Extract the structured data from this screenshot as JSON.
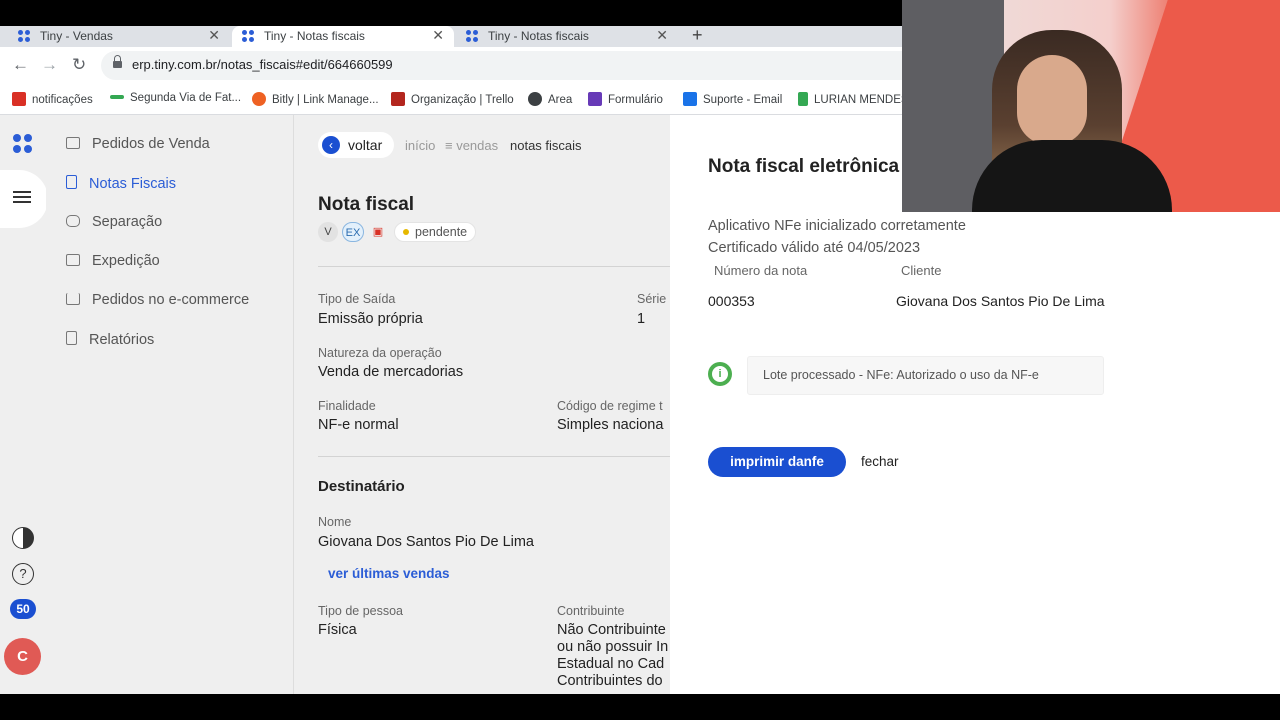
{
  "browser": {
    "tabs": [
      {
        "title": "Tiny - Vendas",
        "active": false
      },
      {
        "title": "Tiny - Notas fiscais",
        "active": true
      },
      {
        "title": "Tiny - Notas fiscais",
        "active": false
      }
    ],
    "close_glyph": "✕",
    "new_tab_glyph": "+",
    "url": "erp.tiny.com.br/notas_fiscais#edit/664660599",
    "bookmarks": [
      {
        "label": "notificações",
        "color": "#d93025"
      },
      {
        "label": "Segunda Via de Fat...",
        "color": "#34a853"
      },
      {
        "label": "Bitly | Link Manage...",
        "color": "#ee6123"
      },
      {
        "label": "Organização | Trello",
        "color": "#b3261e"
      },
      {
        "label": "Area",
        "color": "#3c4043"
      },
      {
        "label": "Formulário",
        "color": "#673ab7"
      },
      {
        "label": "Suporte - Email",
        "color": "#1a73e8"
      },
      {
        "label": "LURIAN MENDES",
        "color": "#34a853"
      }
    ]
  },
  "rail": {
    "badge_count": "50",
    "avatar_letter": "C"
  },
  "sidebar": {
    "items": [
      {
        "label": "Pedidos de Venda",
        "icon": "inbox-icon",
        "active": false
      },
      {
        "label": "Notas Fiscais",
        "icon": "document-icon",
        "active": true
      },
      {
        "label": "Separação",
        "icon": "boxes-icon",
        "active": false
      },
      {
        "label": "Expedição",
        "icon": "truck-icon",
        "active": false
      },
      {
        "label": "Pedidos no e-commerce",
        "icon": "cart-icon",
        "active": false
      },
      {
        "label": "Relatórios",
        "icon": "report-icon",
        "active": false
      }
    ]
  },
  "main": {
    "back_label": "voltar",
    "breadcrumb": [
      "início",
      "≡ vendas",
      "notas fiscais"
    ],
    "title": "Nota fiscal",
    "chips": [
      "V",
      "EX"
    ],
    "status": "pendente",
    "fields": {
      "tipo_saida_label": "Tipo de Saída",
      "tipo_saida_value": "Emissão própria",
      "serie_label": "Série",
      "serie_value": "1",
      "natureza_label": "Natureza da operação",
      "natureza_value": "Venda de mercadorias",
      "finalidade_label": "Finalidade",
      "finalidade_value": "NF-e normal",
      "regime_label": "Código de regime t",
      "regime_value": "Simples naciona"
    },
    "destinatario_title": "Destinatário",
    "nome_label": "Nome",
    "nome_value": "Giovana Dos Santos Pio De Lima",
    "ver_vendas": "ver últimas vendas",
    "tipo_pessoa_label": "Tipo de pessoa",
    "tipo_pessoa_value": "Física",
    "contribuinte_label": "Contribuinte",
    "contribuinte_lines": [
      "Não Contribuinte",
      "ou não possuir In",
      "Estadual no Cad",
      "Contribuintes do"
    ]
  },
  "modal": {
    "title": "Nota fiscal eletrônica",
    "line1": "Aplicativo NFe inicializado corretamente",
    "line2": "Certificado válido até 04/05/2023",
    "numero_label": "Número da nota",
    "cliente_label": "Cliente",
    "numero_value": "000353",
    "cliente_value": "Giovana Dos Santos Pio De Lima",
    "message": "Lote processado - NFe: Autorizado o uso da NF-e",
    "print_button": "imprimir danfe",
    "close_button": "fechar"
  }
}
